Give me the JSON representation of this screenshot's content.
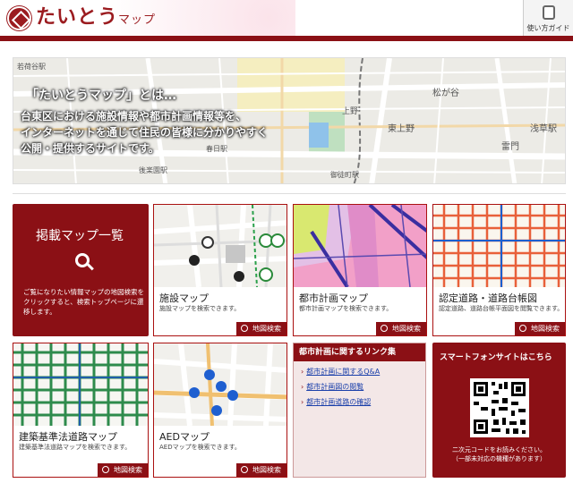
{
  "header": {
    "logo_text": "たいとう",
    "logo_suffix": "マップ",
    "guide_label": "使い方ガイド"
  },
  "hero": {
    "title": "「たいとうマップ」とは…",
    "lines": [
      "台東区における施設情報や都市計画情報等を、",
      "インターネットを通じて住民の皆様に分かりやすく",
      "公開・提供するサイトです。"
    ],
    "map_labels": [
      "若荷谷駅",
      "松が谷",
      "浅草駅",
      "東上野",
      "雷門",
      "上野",
      "御徒町駅",
      "後楽園駅",
      "春日駅"
    ]
  },
  "list_tile": {
    "title": "掲載マップ一覧",
    "desc": "ご覧になりたい情報マップの地図検索をクリックすると、検索トップページに遷移します。"
  },
  "tiles": [
    {
      "title": "施設マップ",
      "desc": "施設マップを検索できます。",
      "button": "地図検索"
    },
    {
      "title": "都市計画マップ",
      "desc": "都市計画マップを検索できます。",
      "button": "地図検索"
    },
    {
      "title": "認定道路・道路台帳図",
      "desc": "認定道路、道路台帳平面図を閲覧できます。",
      "button": "地図検索"
    },
    {
      "title": "建築基準法道路マップ",
      "desc": "建築基準法道路マップを検索できます。",
      "button": "地図検索"
    },
    {
      "title": "AEDマップ",
      "desc": "AEDマップを検索できます。",
      "button": "地図検索"
    }
  ],
  "links": {
    "heading": "都市計画に関するリンク集",
    "items": [
      "都市計画に関するQ&A",
      "都市計画図の閲覧",
      "都市計画道路の確認"
    ]
  },
  "smartphone": {
    "heading": "スマートフォンサイトはこちら",
    "note1": "二次元コードをお読みください。",
    "note2": "（一部未対応の機種があります）"
  }
}
